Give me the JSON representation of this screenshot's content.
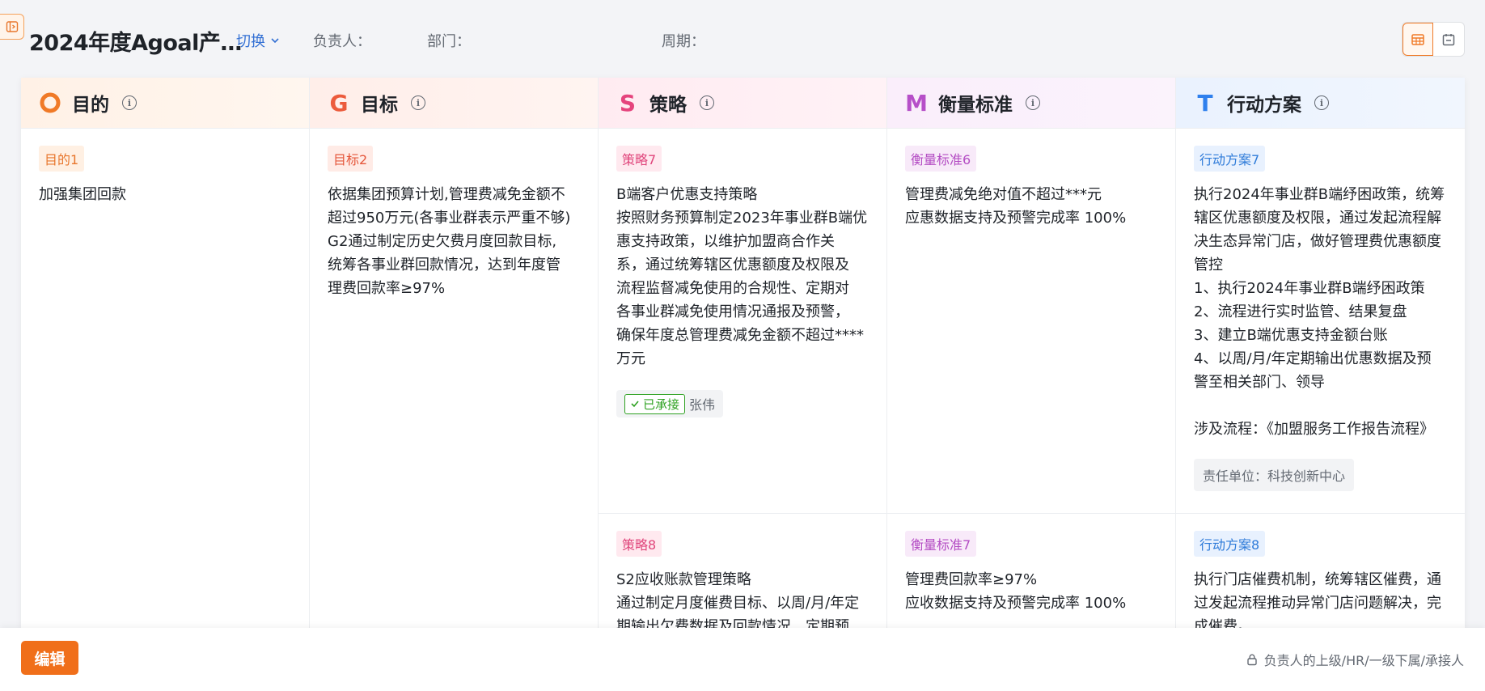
{
  "header": {
    "title": "2024年度Agoal产…",
    "switch_label": "切换",
    "owner_label": "负责人：",
    "owner_value": "",
    "dept_label": "部门：",
    "dept_value": "",
    "period_label": "周期：",
    "period_value": ""
  },
  "columns": [
    {
      "key": "purpose",
      "title": "目的",
      "icon": "O",
      "color": "#f07a27"
    },
    {
      "key": "goal",
      "title": "目标",
      "icon": "G",
      "color": "#ec5b3c"
    },
    {
      "key": "strategy",
      "title": "策略",
      "icon": "S",
      "color": "#e5447d"
    },
    {
      "key": "measure",
      "title": "衡量标准",
      "icon": "M",
      "color": "#b64fc8"
    },
    {
      "key": "action",
      "title": "行动方案",
      "icon": "T",
      "color": "#2f80ed"
    }
  ],
  "cards": {
    "purpose1": {
      "tag": "目的1",
      "text": "加强集团回款"
    },
    "goal2": {
      "tag": "目标2",
      "text": "依据集团预算计划,管理费减免金额不\n超过950万元(各事业群表示严重不够)\nG2通过制定历史欠费月度回款目标,\n统筹各事业群回款情况，达到年度管\n理费回款率≥97%"
    },
    "strategy7": {
      "tag": "策略7",
      "text": "B端客户优惠支持策略\n按照财务预算制定2023年事业群B端优\n惠支持政策，以维护加盟商合作关\n系，通过统筹辖区优惠额度及权限及\n流程监督减免使用的合规性、定期对\n各事业群减免使用情况通报及预警，\n确保年度总管理费减免金额不超过****\n万元",
      "accepted_label": "已承接",
      "accepted_by": "张伟"
    },
    "measure6": {
      "tag": "衡量标准6",
      "text": "管理费减免绝对值不超过***元\n应惠数据支持及预警完成率 100%"
    },
    "action7": {
      "tag": "行动方案7",
      "text": "执行2024年事业群B端纾困政策，统筹\n辖区优惠额度及权限，通过发起流程解\n决生态异常门店，做好管理费优惠额度\n管控\n1、执行2024年事业群B端纾困政策\n2、流程进行实时监管、结果复盘\n3、建立B端优惠支持金额台账\n4、以周/月/年定期输出优惠数据及预\n警至相关部门、领导\n\n涉及流程：《加盟服务工作报告流程》",
      "unit": "责任单位：科技创新中心"
    },
    "strategy8": {
      "tag": "策略8",
      "text": "S2应收账款管理策略\n通过制定月度催费目标、以周/月/年定\n期输出欠费数据及回款情况、定期预"
    },
    "measure7": {
      "tag": "衡量标准7",
      "text": "管理费回款率≥97%\n应收数据支持及预警完成率 100%"
    },
    "action8": {
      "tag": "行动方案8",
      "text": "执行门店催费机制，统筹辖区催费，通\n过发起流程推动异常门店问题解决，完\n成催费。"
    }
  },
  "footer": {
    "edit_label": "编辑",
    "permission_text": "负责人的上级/HR/一级下属/承接人"
  }
}
